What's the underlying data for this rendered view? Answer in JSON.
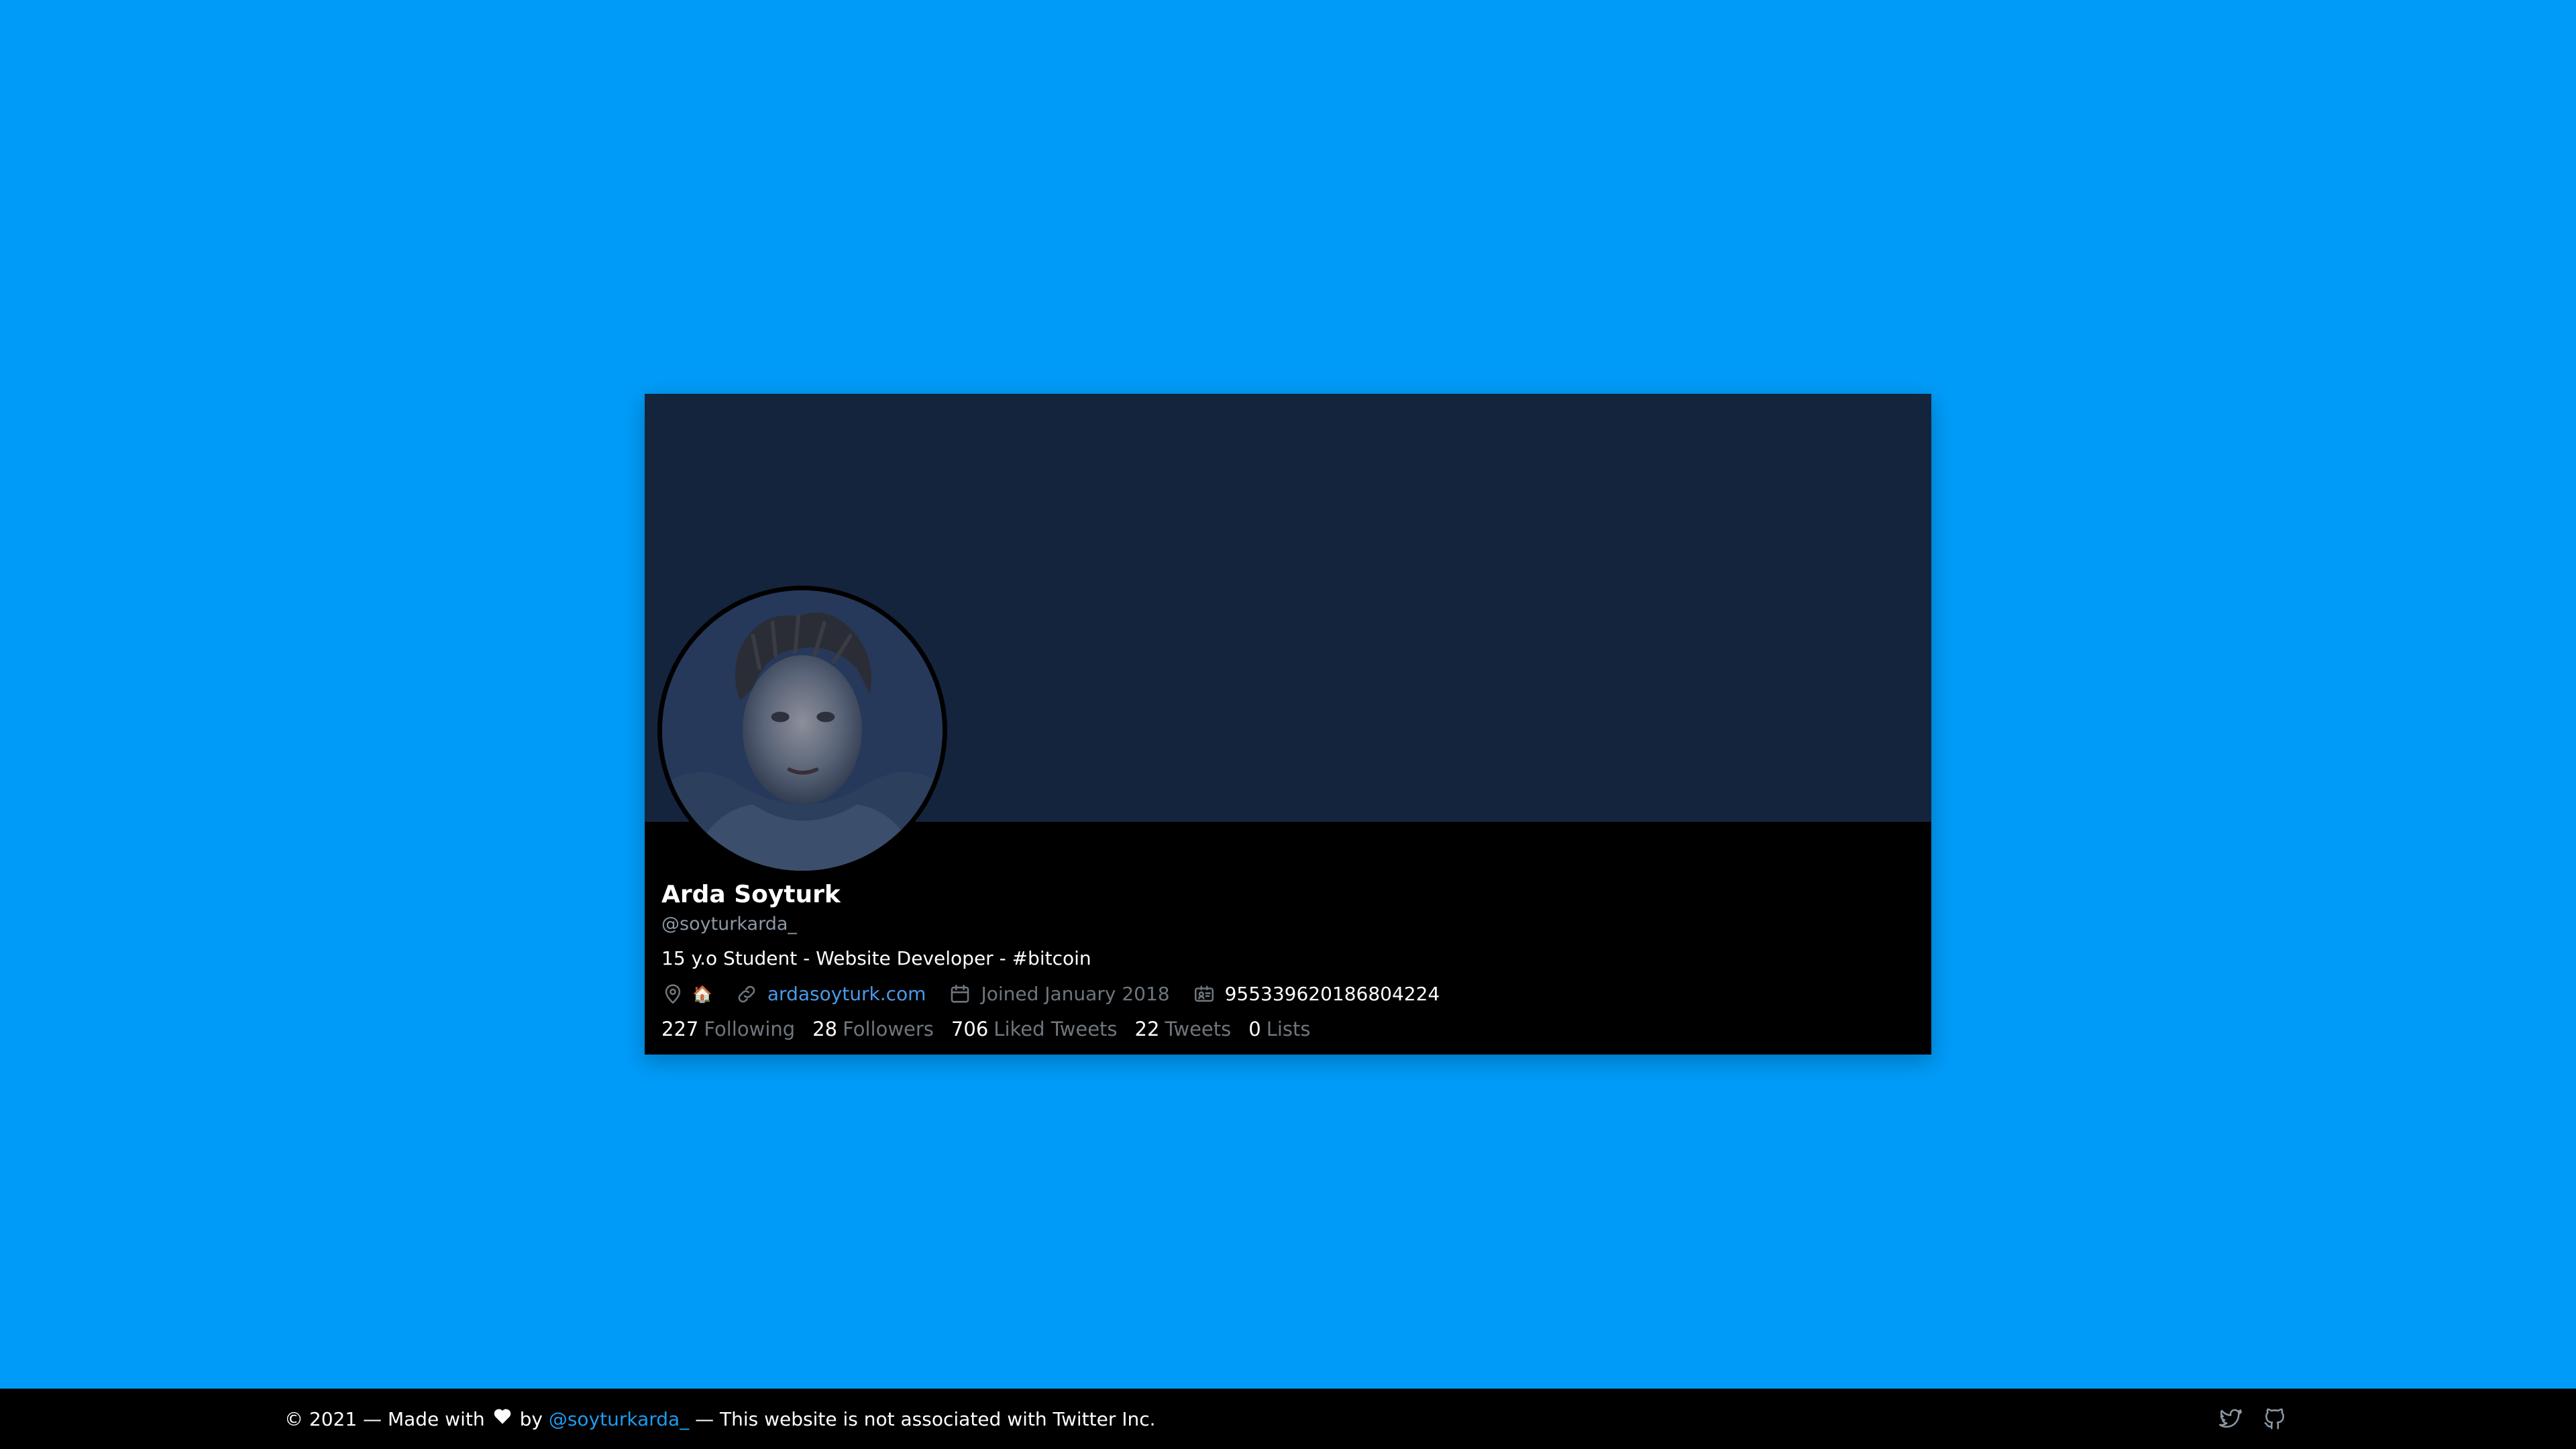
{
  "profile": {
    "name": "Arda Soyturk",
    "handle": "@soyturkarda_",
    "bio": "15 y.o Student - Website Developer - #bitcoin",
    "location_emoji": "🏠",
    "website": "ardasoyturk.com",
    "joined": "Joined January 2018",
    "user_id": "955339620186804224",
    "icons": {
      "location": "location-pin-icon",
      "link": "link-icon",
      "calendar": "calendar-icon",
      "id_card": "id-card-icon"
    }
  },
  "stats": [
    {
      "value": "227",
      "label": "Following"
    },
    {
      "value": "28",
      "label": "Followers"
    },
    {
      "value": "706",
      "label": "Liked Tweets"
    },
    {
      "value": "22",
      "label": "Tweets"
    },
    {
      "value": "0",
      "label": "Lists"
    }
  ],
  "footer": {
    "prefix": "© 2021 — Made with",
    "by": "by",
    "author": "@soyturkarda_",
    "suffix": "— This website is not associated with Twitter Inc.",
    "icons": [
      "twitter-icon",
      "github-icon"
    ]
  },
  "colors": {
    "page_background": "#009bf8",
    "banner": "#15243d",
    "card": "#000000",
    "link": "#4a99e9",
    "muted": "#6e767d"
  }
}
